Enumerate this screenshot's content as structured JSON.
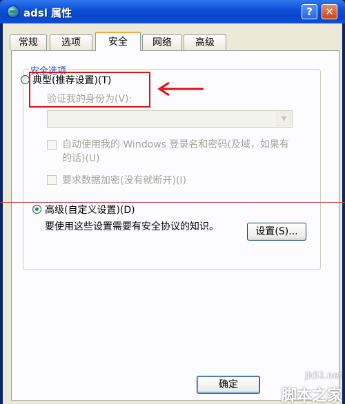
{
  "window": {
    "title": "adsl 属性",
    "help_label": "?",
    "close_label": "✕"
  },
  "tabs": [
    {
      "label": "常规"
    },
    {
      "label": "选项"
    },
    {
      "label": "安全",
      "active": true
    },
    {
      "label": "网络"
    },
    {
      "label": "高级"
    }
  ],
  "security": {
    "group_title": "安全选项",
    "typical": {
      "label": "典型(推荐设置)(T)",
      "checked": false
    },
    "verify_identity_label": "验证我的身份为(V):",
    "identity_select_value": "",
    "autologon": {
      "label": "自动使用我的 Windows 登录名和密码(及域，如果有的话)(U)",
      "checked": false,
      "enabled": false
    },
    "require_encryption": {
      "label": "要求数据加密(没有就断开)(I)",
      "checked": false,
      "enabled": false
    },
    "advanced": {
      "label": "高级(自定义设置)(D)",
      "checked": true
    },
    "advanced_description": "要使用这些设置需要有安全协议的知识。",
    "settings_button": "设置(S)..."
  },
  "footer": {
    "ok_button": "确定"
  },
  "watermark": {
    "url": "jb51.net",
    "name": "脚本之家"
  },
  "colors": {
    "titlebar": "#0a46c8",
    "annotation_red": "#e01010",
    "group_title": "#0046d5"
  }
}
